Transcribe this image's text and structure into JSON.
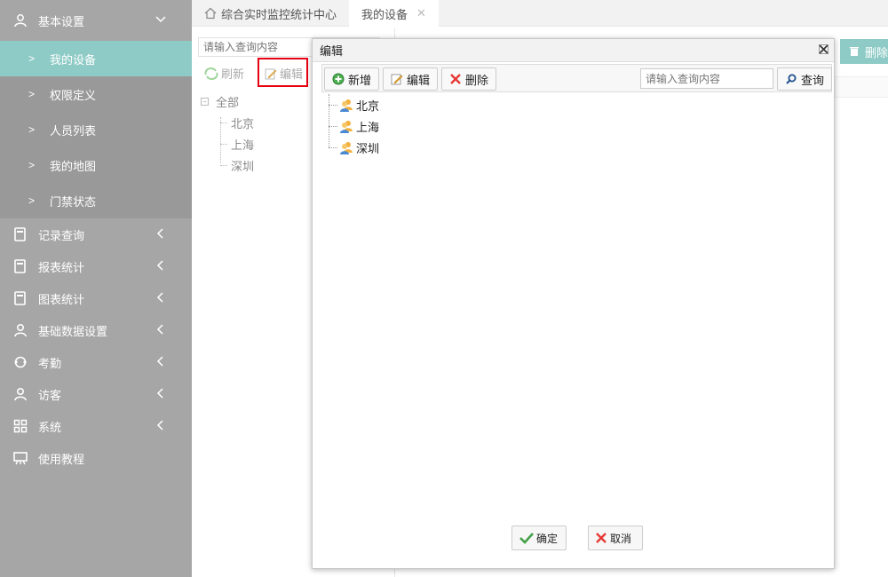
{
  "sidebar": {
    "top": {
      "label": "基本设置",
      "icon": "user-icon"
    },
    "sub_items": [
      {
        "label": "我的设备",
        "active": true
      },
      {
        "label": "权限定义",
        "active": false
      },
      {
        "label": "人员列表",
        "active": false
      },
      {
        "label": "我的地图",
        "active": false
      },
      {
        "label": "门禁状态",
        "active": false
      }
    ],
    "items": [
      {
        "label": "记录查询",
        "icon": "record-icon"
      },
      {
        "label": "报表统计",
        "icon": "report-icon"
      },
      {
        "label": "图表统计",
        "icon": "chart-icon"
      },
      {
        "label": "基础数据设置",
        "icon": "users-icon"
      },
      {
        "label": "考勤",
        "icon": "attendance-icon"
      },
      {
        "label": "访客",
        "icon": "visitor-icon"
      },
      {
        "label": "系统",
        "icon": "grid-icon"
      },
      {
        "label": "使用教程",
        "icon": "tutorial-icon"
      }
    ],
    "colors": {
      "bg": "#a6a6a6",
      "active": "#8fcbc6"
    }
  },
  "tabs": [
    {
      "label": "综合实时监控统计中心",
      "icon": "home-icon"
    },
    {
      "label": "我的设备",
      "closable": true
    }
  ],
  "left_panel": {
    "search_placeholder": "请输入查询内容",
    "refresh_label": "刷新",
    "edit_label": "编辑",
    "tree": {
      "root": "全部",
      "children": [
        "北京",
        "上海",
        "深圳"
      ]
    }
  },
  "background": {
    "delete_label": "删除"
  },
  "dialog": {
    "title": "编辑",
    "toolbar": {
      "add_label": "新增",
      "edit_label": "编辑",
      "delete_label": "删除",
      "search_placeholder": "请输入查询内容",
      "query_label": "查询"
    },
    "tree": [
      "北京",
      "上海",
      "深圳"
    ],
    "ok_label": "确定",
    "cancel_label": "取消"
  }
}
